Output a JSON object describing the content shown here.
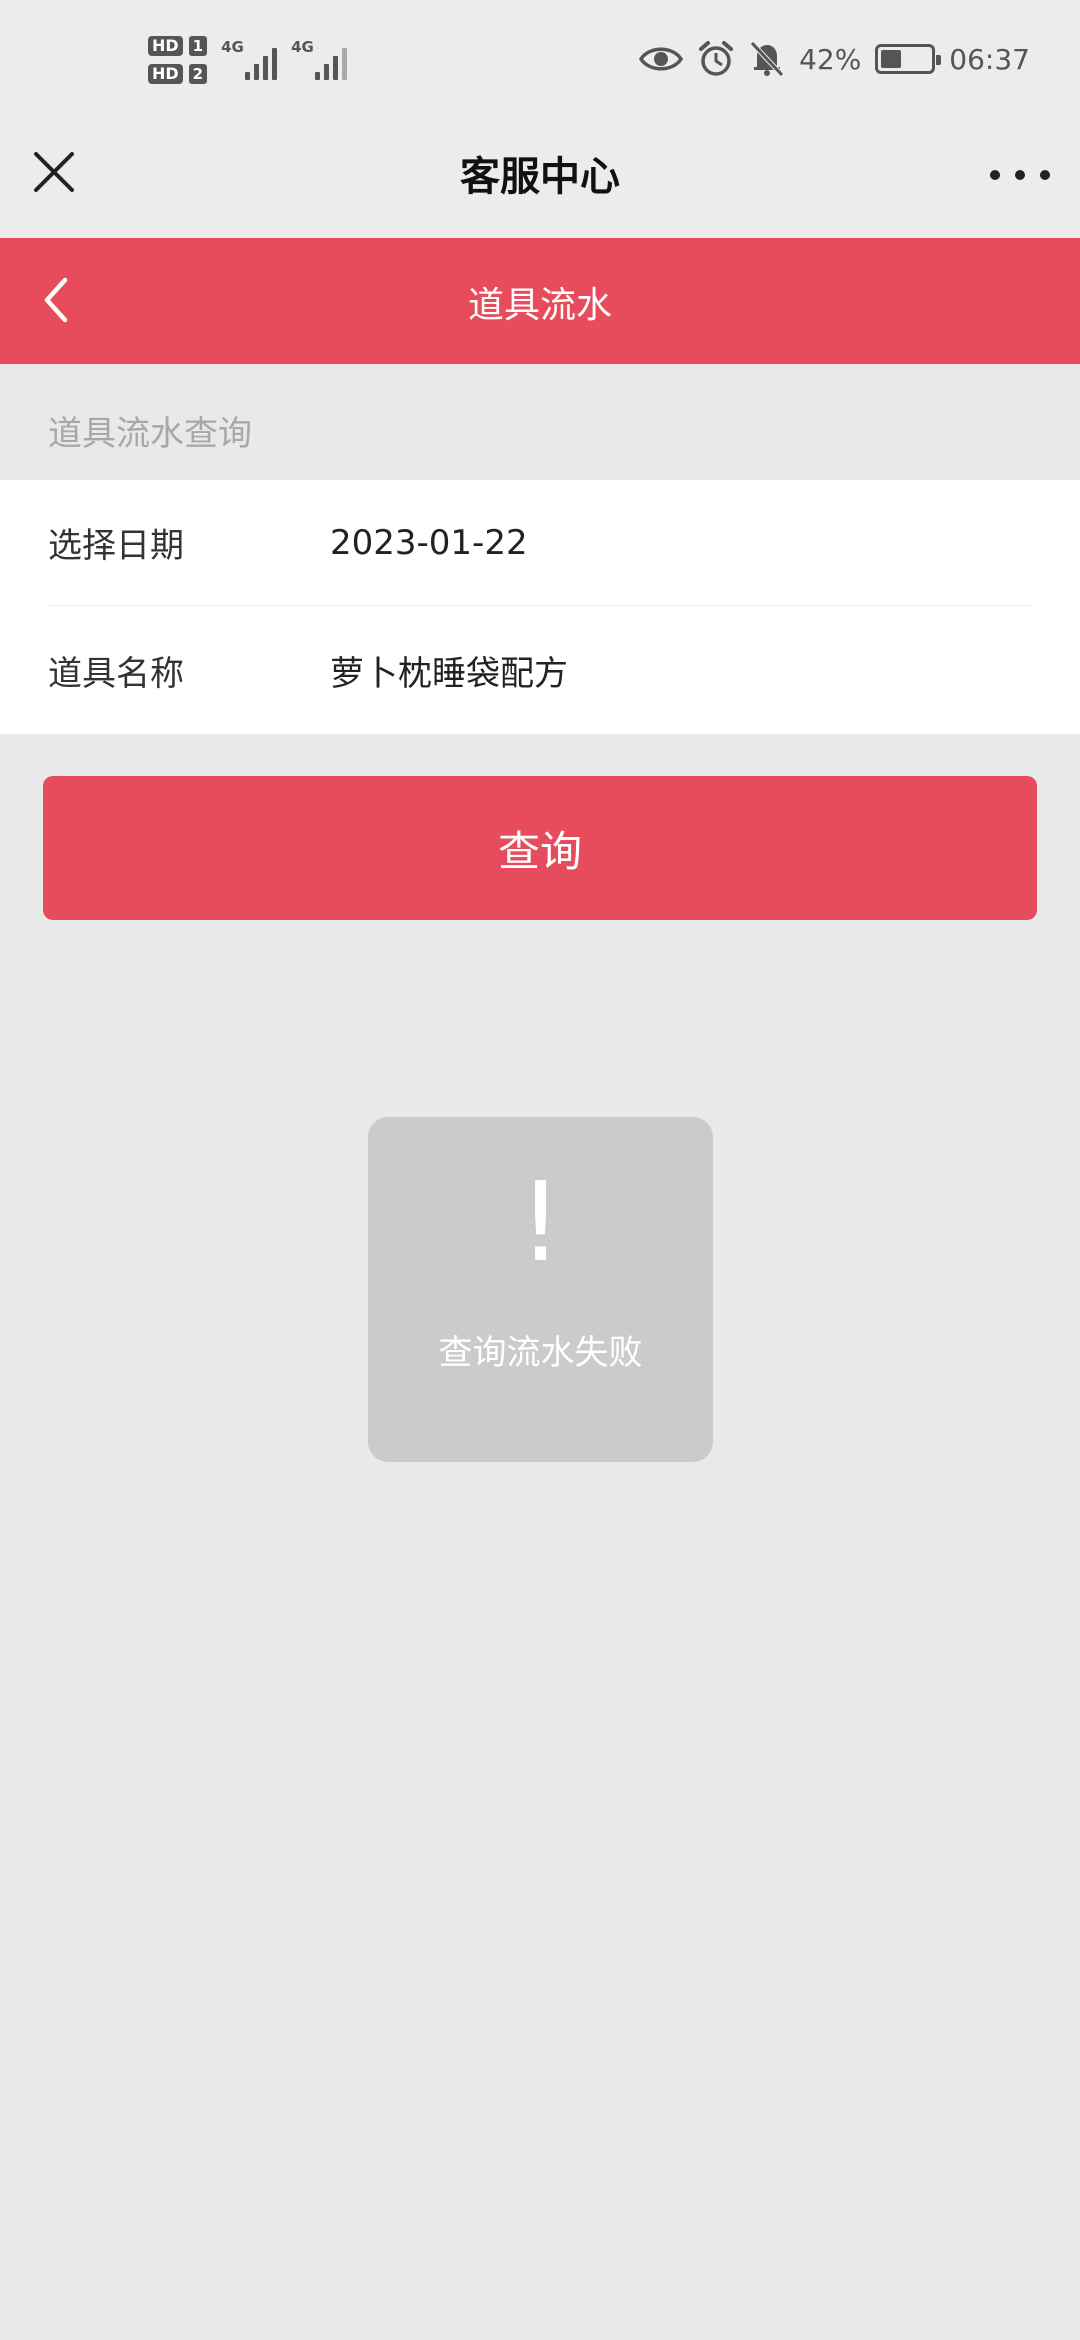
{
  "status_bar": {
    "hd1": "HD",
    "sim1": "1",
    "hd2": "HD",
    "sim2": "2",
    "net1": "4G",
    "net2": "4G",
    "battery_percent": "42%",
    "battery_level": 0.42,
    "time": "06:37",
    "icons": [
      "eye-icon",
      "alarm-icon",
      "mute-icon",
      "battery-icon"
    ]
  },
  "app_header": {
    "title": "客服中心",
    "close_icon": "close-icon",
    "more_icon": "more-dots-icon"
  },
  "nav_bar": {
    "title": "道具流水",
    "back_icon": "chevron-left-icon"
  },
  "section": {
    "label": "道具流水查询"
  },
  "form": {
    "date_label": "选择日期",
    "date_value": "2023-01-22",
    "item_label": "道具名称",
    "item_value": "萝卜枕睡袋配方"
  },
  "query_button": {
    "label": "查询"
  },
  "toast": {
    "icon": "!",
    "message": "查询流水失败"
  },
  "colors": {
    "accent": "#e74c5c",
    "background": "#e9e9e9",
    "toast_bg": "#cbcbcb"
  }
}
